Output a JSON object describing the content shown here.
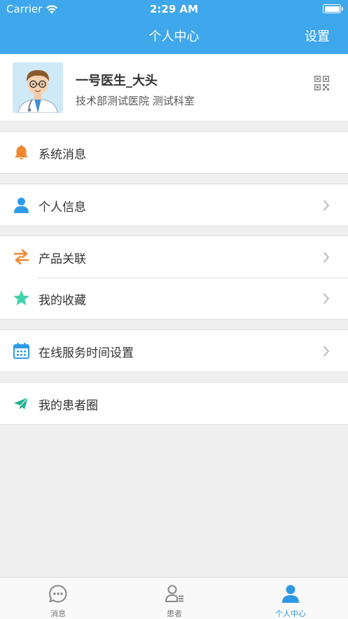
{
  "status_bar": {
    "carrier": "Carrier",
    "time": "2:29 AM",
    "battery_level": 1.0
  },
  "nav": {
    "title": "个人中心",
    "right_button": "设置"
  },
  "profile": {
    "name": "一号医生_大头",
    "org": "技术部测试医院 测试科室",
    "avatar_icon": "doctor-avatar",
    "qr_icon": "qr-code-icon"
  },
  "menu_groups": [
    [
      {
        "label": "系统消息",
        "icon": "bell-icon",
        "color": "#f0882f",
        "has_chevron": false
      }
    ],
    [
      {
        "label": "个人信息",
        "icon": "person-icon",
        "color": "#2f9be8",
        "has_chevron": true
      }
    ],
    [
      {
        "label": "产品关联",
        "icon": "swap-arrows-icon",
        "color": "#f0882f",
        "has_chevron": true
      },
      {
        "label": "我的收藏",
        "icon": "star-icon",
        "color": "#3ed3a8",
        "has_chevron": true
      }
    ],
    [
      {
        "label": "在线服务时间设置",
        "icon": "calendar-icon",
        "color": "#2f9be8",
        "has_chevron": true
      }
    ],
    [
      {
        "label": "我的患者圈",
        "icon": "send-icon",
        "color": "#20b38f",
        "has_chevron": false
      }
    ]
  ],
  "tabs": [
    {
      "label": "消息",
      "icon": "chat-bubble-icon",
      "active": false
    },
    {
      "label": "患者",
      "icon": "patient-list-icon",
      "active": false
    },
    {
      "label": "个人中心",
      "icon": "person-filled-icon",
      "active": true
    }
  ],
  "colors": {
    "header": "#3fa7ec",
    "active_tab": "#2e98e3",
    "background": "#efefef"
  }
}
